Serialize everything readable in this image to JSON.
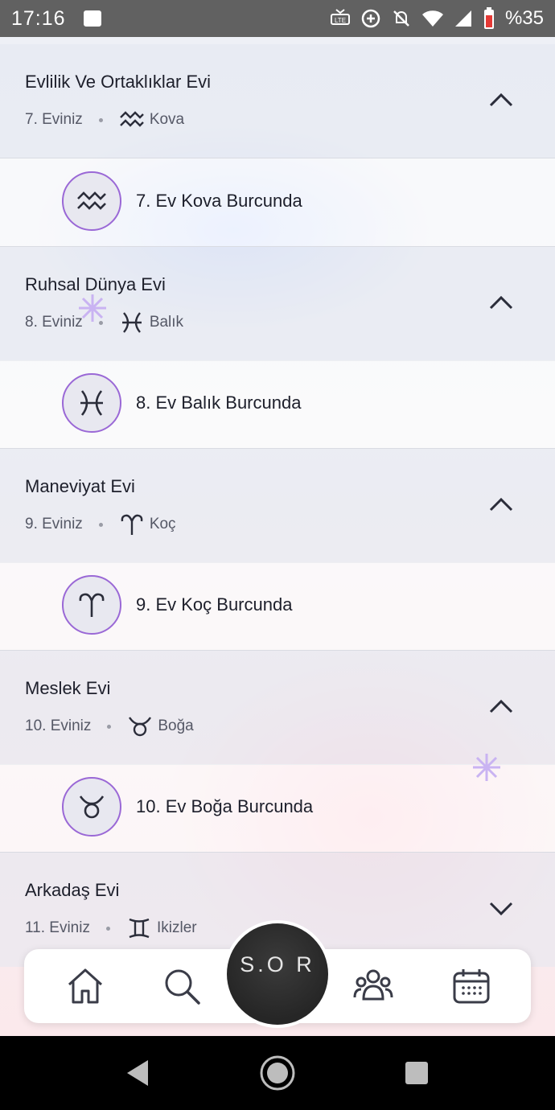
{
  "status_bar": {
    "time": "17:16",
    "battery": "%35"
  },
  "houses": [
    {
      "title": "Evlilik Ve Ortaklıklar Evi",
      "house": "7. Eviniz",
      "sign": "Kova",
      "sign_icon": "aquarius-icon",
      "detail": "7. Ev Kova Burcunda",
      "expanded": true
    },
    {
      "title": "Ruhsal Dünya Evi",
      "house": "8. Eviniz",
      "sign": "Balık",
      "sign_icon": "pisces-icon",
      "detail": "8. Ev Balık Burcunda",
      "expanded": true
    },
    {
      "title": "Maneviyat Evi",
      "house": "9. Eviniz",
      "sign": "Koç",
      "sign_icon": "aries-icon",
      "detail": "9. Ev Koç Burcunda",
      "expanded": true
    },
    {
      "title": "Meslek Evi",
      "house": "10. Eviniz",
      "sign": "Boğa",
      "sign_icon": "taurus-icon",
      "detail": "10. Ev Boğa Burcunda",
      "expanded": true
    },
    {
      "title": "Arkadaş Evi",
      "house": "11. Eviniz",
      "sign": "Ikizler",
      "sign_icon": "gemini-icon",
      "expanded": false
    }
  ],
  "bottom_nav": {
    "center_label": "S.O R",
    "items": [
      "home-icon",
      "search-icon",
      "community-icon",
      "calendar-icon"
    ]
  },
  "colors": {
    "accent": "#9a68d6",
    "sparkle": "#c9b3f2"
  }
}
